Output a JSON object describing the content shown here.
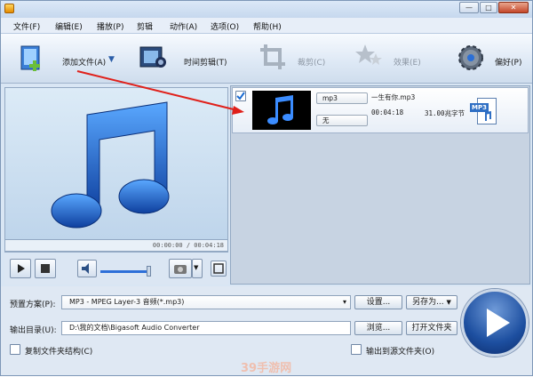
{
  "window": {
    "minimize": "—",
    "maximize": "□",
    "close": "✕"
  },
  "menu": [
    "文件(F)",
    "编辑(E)",
    "播放(P)",
    "剪辑",
    "动作(A)",
    "选项(O)",
    "帮助(H)"
  ],
  "toolbar": {
    "add_file": "添加文件(A)",
    "trim": "时间剪辑(T)",
    "crop": "裁剪(C)",
    "effect": "效果(E)",
    "prefs": "偏好(P)"
  },
  "preview": {
    "time": "00:00:00 / 00:04:18"
  },
  "file": {
    "title": "一生有你.mp3",
    "format": "mp3",
    "subtitle": "无",
    "duration": "00:04:18",
    "size": "31.00兆字节",
    "badge": "MP3"
  },
  "bottom": {
    "preset_label": "预置方案(P):",
    "preset_value": "MP3 - MPEG Layer-3 音频(*.mp3)",
    "settings": "设置...",
    "save_as": "另存为...",
    "output_label": "输出目录(U):",
    "output_value": "D:\\我的文档\\Bigasoft Audio Converter",
    "browse": "浏览...",
    "open_folder": "打开文件夹",
    "copy_structure": "复制文件夹结构(C)",
    "output_to_source": "输出到源文件夹(O)"
  },
  "watermark": "39手游网",
  "colors": {
    "accent": "#2b6fd6",
    "arrow": "#e0201a",
    "window_bg": "#d9e6f4"
  }
}
